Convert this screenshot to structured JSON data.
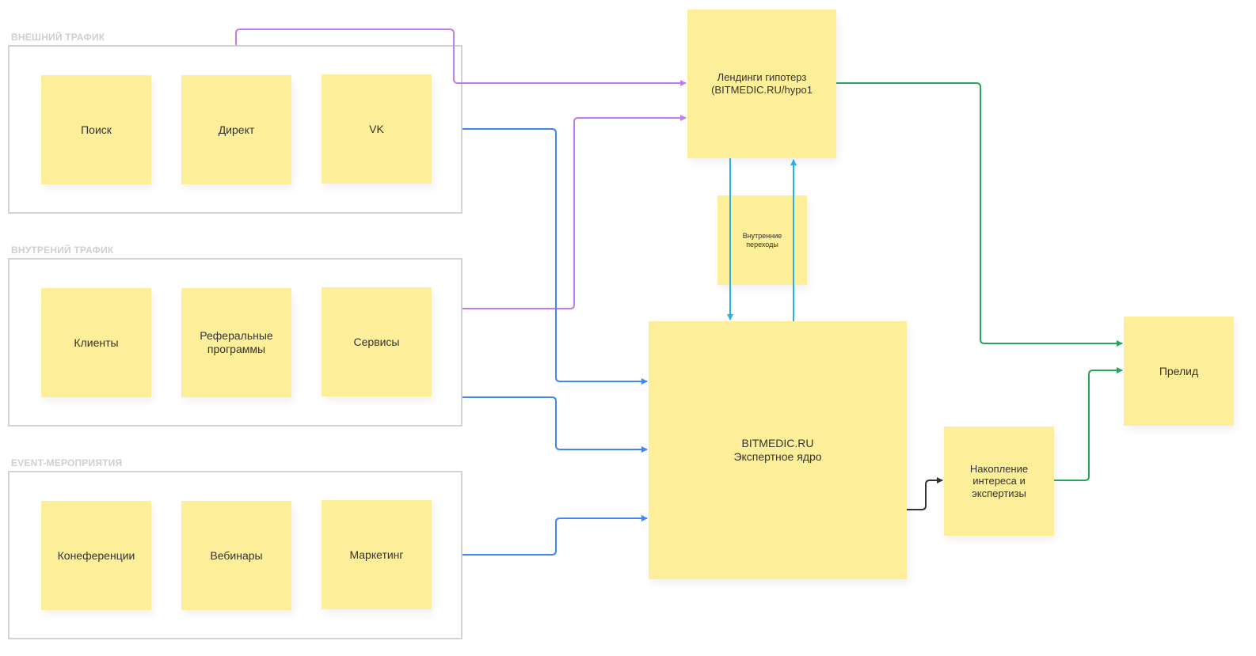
{
  "groups": {
    "external": {
      "label": "ВНЕШНИЙ ТРАФИК"
    },
    "internal": {
      "label": "ВНУТРЕНИЙ ТРАФИК"
    },
    "event": {
      "label": "EVENT-МЕРОПРИЯТИЯ"
    }
  },
  "notes": {
    "search": "Поиск",
    "direct": "Директ",
    "vk": "VK",
    "clients": "Клиенты",
    "referral": "Реферальные\nпрограммы",
    "services": "Сервисы",
    "conferences": "Конеференции",
    "webinars": "Вебинары",
    "marketing": "Маркетинг",
    "landings": "Лендинги гипотерз\n(BITMEDIC.RU/hypo1",
    "internal_transitions": "Внутренние\nпереходы",
    "core": "BITMEDIC.RU\nЭкспертное ядро",
    "accumulation": "Накопление\nинтереса и\nэкспертизы",
    "prelid": "Прелид"
  },
  "colors": {
    "sticky": "#fdee9a",
    "frame": "#d3d3d3",
    "purple": "#c77bf0",
    "blue": "#4287f0",
    "cyan": "#2bb0e6",
    "green": "#26a65b",
    "dark": "#333333"
  }
}
